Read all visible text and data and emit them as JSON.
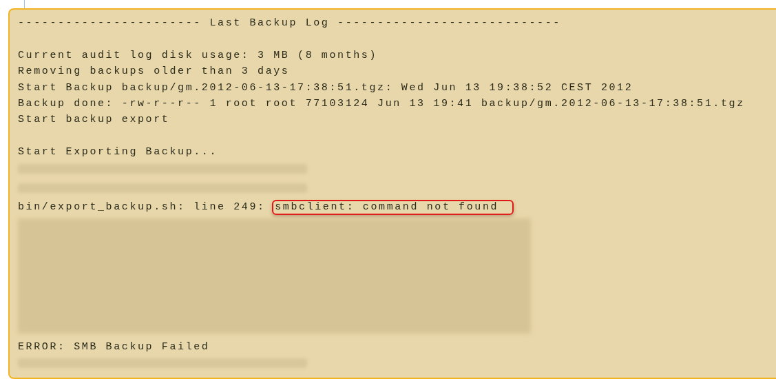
{
  "log_panel": {
    "lines": [
      {
        "kind": "text",
        "text": "----------------------- Last Backup Log ----------------------------"
      },
      {
        "kind": "blank"
      },
      {
        "kind": "text",
        "text": "Current audit log disk usage: 3 MB (8 months)"
      },
      {
        "kind": "text",
        "text": "Removing backups older than 3 days"
      },
      {
        "kind": "text",
        "text": "Start Backup backup/gm.2012-06-13-17:38:51.tgz: Wed Jun 13 19:38:52 CEST 2012"
      },
      {
        "kind": "text",
        "text": "Backup done: -rw-r--r-- 1 root root 77103124 Jun 13 19:41 backup/gm.2012-06-13-17:38:51.tgz"
      },
      {
        "kind": "text",
        "text": "Start backup export"
      },
      {
        "kind": "blank"
      },
      {
        "kind": "text",
        "text": "Start Exporting Backup..."
      },
      {
        "kind": "redacted"
      },
      {
        "kind": "redacted"
      },
      {
        "kind": "highlight",
        "text": "bin/export_backup.sh: line 249: ",
        "highlight": "smbclient: command not found"
      },
      {
        "kind": "redacted_block"
      },
      {
        "kind": "text",
        "text": "ERROR: SMB Backup Failed"
      },
      {
        "kind": "redacted"
      }
    ]
  }
}
